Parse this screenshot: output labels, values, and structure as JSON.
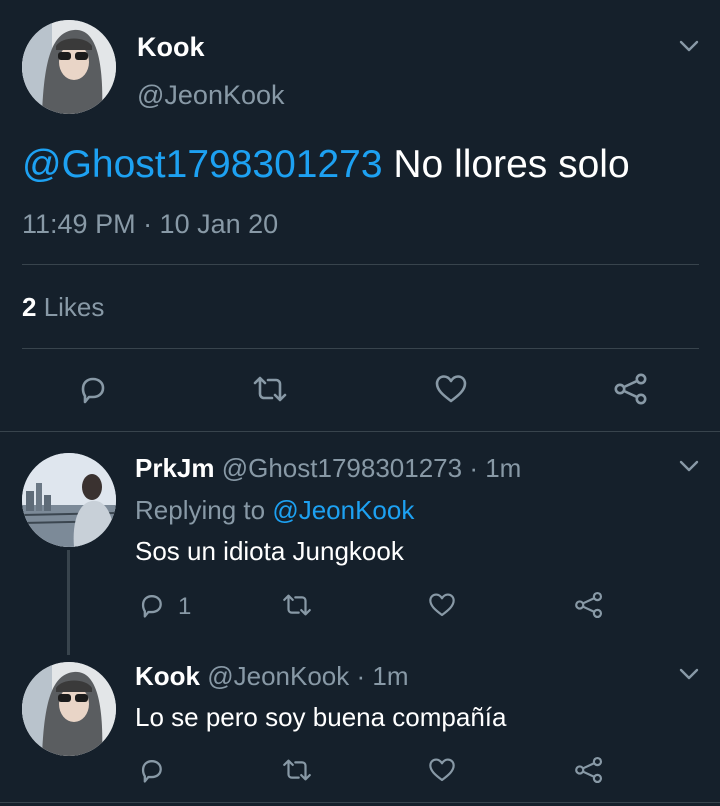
{
  "main_tweet": {
    "display_name": "Kook",
    "handle": "@JeonKook",
    "mention": "@Ghost1798301273",
    "text": " No llores solo",
    "timestamp": "11:49 PM · 10 Jan 20",
    "likes_count": "2",
    "likes_label": " Likes"
  },
  "replies": [
    {
      "display_name": "PrkJm",
      "handle": "@Ghost1798301273",
      "time": " · 1m",
      "replying_prefix": "Replying to ",
      "replying_to": "@JeonKook",
      "text": "Sos un idiota Jungkook",
      "reply_count": "1"
    },
    {
      "display_name": "Kook",
      "handle": "@JeonKook",
      "time": " · 1m",
      "text": "Lo se pero soy buena compañía"
    }
  ],
  "colors": {
    "background": "#15202b",
    "secondary_text": "#8899a6",
    "accent": "#1da1f2",
    "divider": "#38444d"
  }
}
